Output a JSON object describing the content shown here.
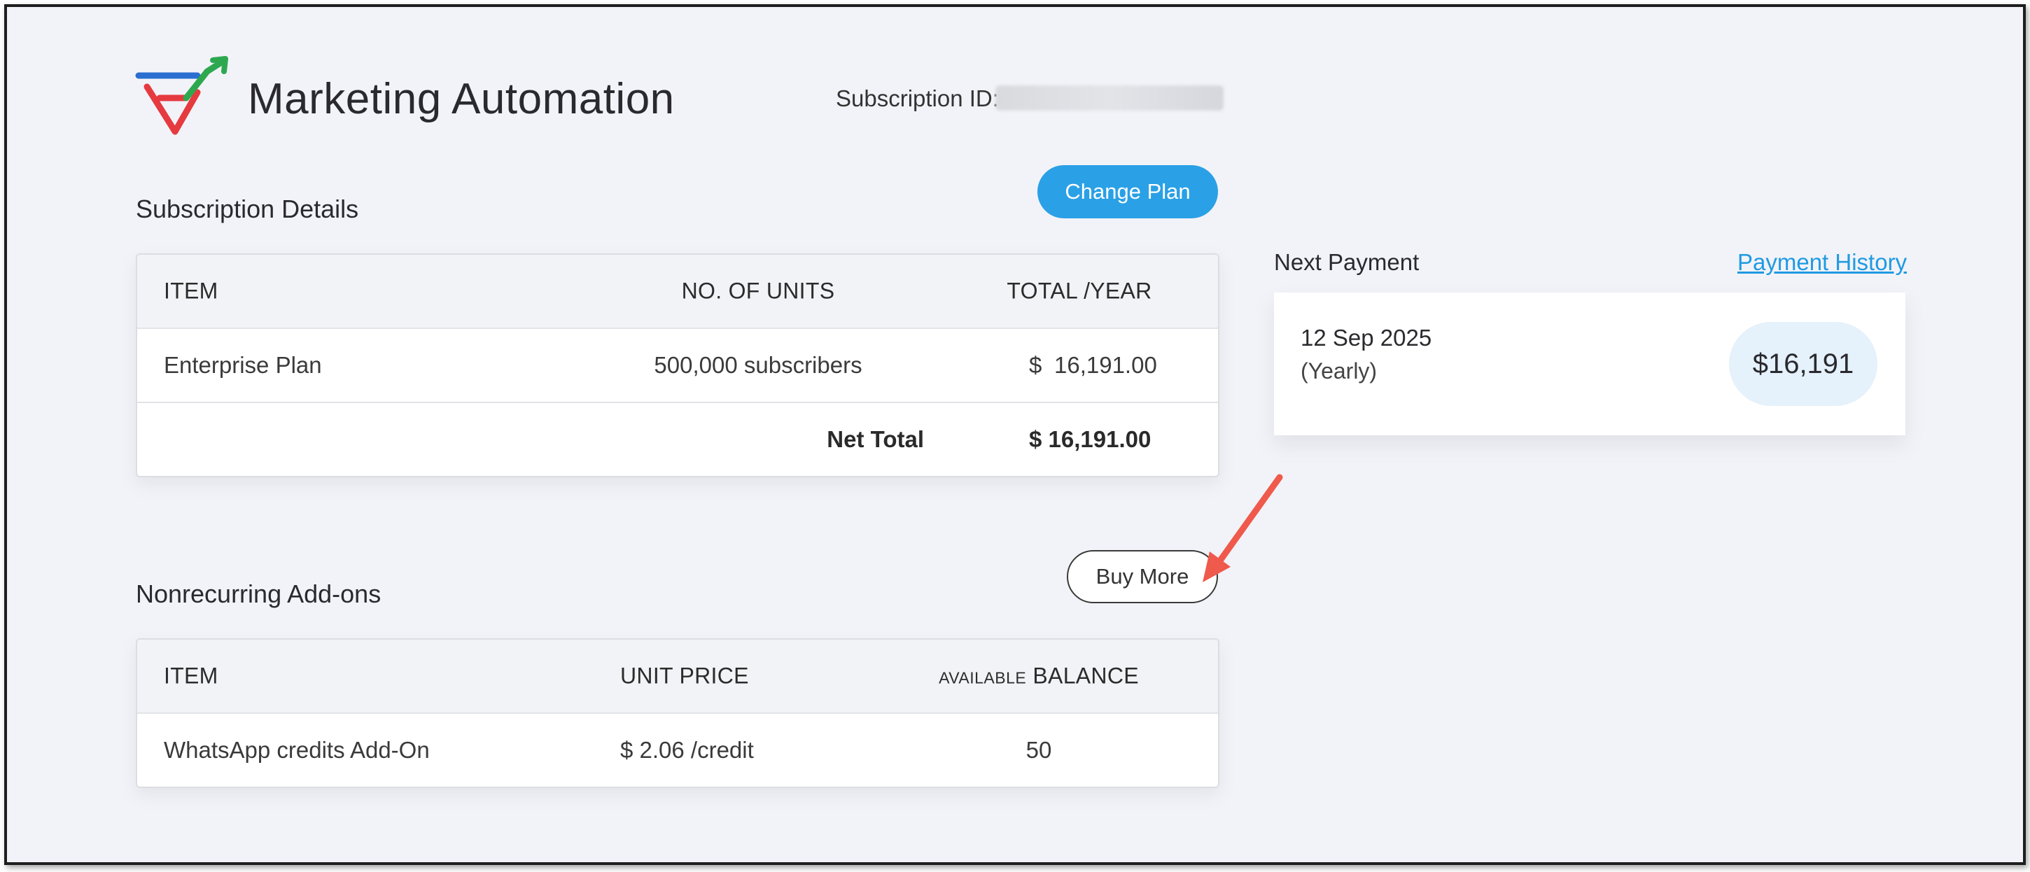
{
  "header": {
    "app_title": "Marketing Automation",
    "subscription_id_label": "Subscription ID:"
  },
  "subscription": {
    "title": "Subscription Details",
    "change_plan_label": "Change Plan",
    "columns": [
      "ITEM",
      "NO. OF UNITS",
      "TOTAL /YEAR"
    ],
    "rows": [
      {
        "item": "Enterprise Plan",
        "units": "500,000 subscribers",
        "currency": "$",
        "total": "16,191.00"
      }
    ],
    "net_total_label": "Net Total",
    "net_total_value": "$ 16,191.00"
  },
  "addons": {
    "title": "Nonrecurring Add-ons",
    "buy_more_label": "Buy More",
    "columns": {
      "item": "ITEM",
      "unit_price": "UNIT PRICE",
      "balance_prefix": "AVAILABLE",
      "balance": "BALANCE"
    },
    "rows": [
      {
        "item": "WhatsApp credits Add-On",
        "unit_price": "$ 2.06 /credit",
        "balance": "50"
      }
    ]
  },
  "next_payment": {
    "title": "Next Payment",
    "history_link": "Payment History",
    "date": "12 Sep 2025",
    "frequency": "(Yearly)",
    "amount": "$16,191"
  },
  "colors": {
    "accent": "#2aa0e6",
    "link": "#1f9ae2",
    "annotation_arrow": "#ef5a4c",
    "background": "#f2f3f8"
  },
  "icons": {
    "logo": "marketing-automation-logo",
    "annotation": "red-arrow-annotation"
  }
}
